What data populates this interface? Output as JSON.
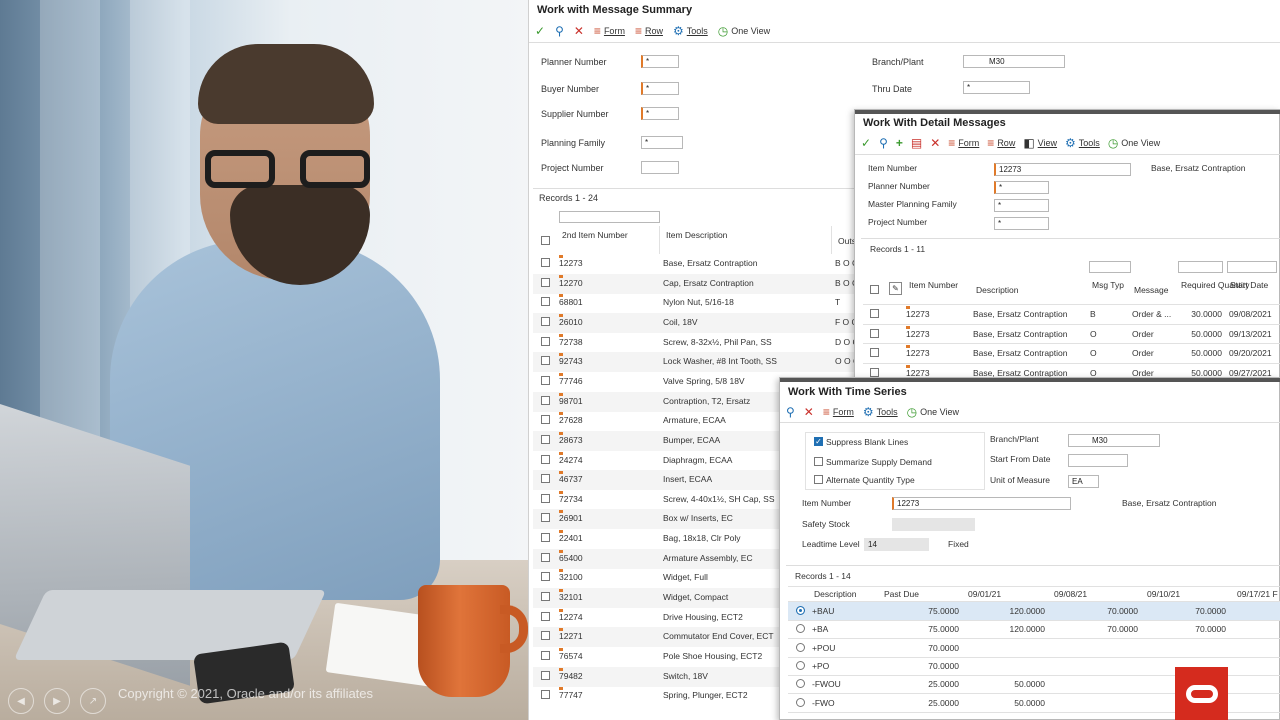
{
  "copyright": "Copyright © 2021, Oracle and/or its affiliates",
  "photo_controls": [
    "prev-icon",
    "next-icon",
    "expand-icon"
  ],
  "colors": {
    "required_flag": "#e07a2a",
    "link": "#1f5c99",
    "oracle_red": "#d52b1e"
  },
  "msg_summary": {
    "title": "Work with Message Summary",
    "toolbar": {
      "form": "Form",
      "row": "Row",
      "tools": "Tools",
      "one_view": "One View"
    },
    "fields": {
      "planner_number": {
        "label": "Planner Number",
        "value": "*"
      },
      "buyer_number": {
        "label": "Buyer Number",
        "value": "*"
      },
      "supplier_number": {
        "label": "Supplier Number",
        "value": "*"
      },
      "planning_family": {
        "label": "Planning Family",
        "value": "*"
      },
      "project_number": {
        "label": "Project Number",
        "value": ""
      },
      "branch_plant": {
        "label": "Branch/Plant",
        "value": "M30"
      },
      "thru_date": {
        "label": "Thru Date",
        "value": "*"
      }
    },
    "records_label": "Records 1 - 24",
    "columns": {
      "item_number": "2nd Item Number",
      "item_desc": "Item Description",
      "outs": "Outs"
    },
    "rows": [
      {
        "item": "12273",
        "desc": "Base, Ersatz Contraption",
        "outs": "B O C"
      },
      {
        "item": "12270",
        "desc": "Cap, Ersatz Contraption",
        "outs": "B O C"
      },
      {
        "item": "68801",
        "desc": "Nylon Nut, 5/16-18",
        "outs": "T"
      },
      {
        "item": "26010",
        "desc": "Coil, 18V",
        "outs": "F O C"
      },
      {
        "item": "72738",
        "desc": "Screw, 8-32x½, Phil Pan, SS",
        "outs": "D O C"
      },
      {
        "item": "92743",
        "desc": "Lock Washer, #8 Int Tooth, SS",
        "outs": "O O C"
      },
      {
        "item": "77746",
        "desc": "Valve Spring, 5/8 18V",
        "outs": ""
      },
      {
        "item": "98701",
        "desc": "Contraption, T2, Ersatz",
        "outs": ""
      },
      {
        "item": "27628",
        "desc": "Armature, ECAA",
        "outs": ""
      },
      {
        "item": "28673",
        "desc": "Bumper, ECAA",
        "outs": ""
      },
      {
        "item": "24274",
        "desc": "Diaphragm, ECAA",
        "outs": ""
      },
      {
        "item": "46737",
        "desc": "Insert, ECAA",
        "outs": ""
      },
      {
        "item": "72734",
        "desc": "Screw, 4-40x1½, SH Cap, SS",
        "outs": ""
      },
      {
        "item": "26901",
        "desc": "Box w/ Inserts, EC",
        "outs": ""
      },
      {
        "item": "22401",
        "desc": "Bag, 18x18, Clr Poly",
        "outs": ""
      },
      {
        "item": "65400",
        "desc": "Armature Assembly, EC",
        "outs": ""
      },
      {
        "item": "32100",
        "desc": "Widget, Full",
        "outs": ""
      },
      {
        "item": "32101",
        "desc": "Widget, Compact",
        "outs": ""
      },
      {
        "item": "12274",
        "desc": "Drive Housing, ECT2",
        "outs": ""
      },
      {
        "item": "12271",
        "desc": "Commutator End Cover, ECT",
        "outs": ""
      },
      {
        "item": "76574",
        "desc": "Pole Shoe Housing, ECT2",
        "outs": ""
      },
      {
        "item": "79482",
        "desc": "Switch, 18V",
        "outs": ""
      },
      {
        "item": "77747",
        "desc": "Spring, Plunger, ECT2",
        "outs": ""
      }
    ]
  },
  "detail_msgs": {
    "title": "Work With Detail Messages",
    "toolbar": {
      "form": "Form",
      "row": "Row",
      "view": "View",
      "tools": "Tools",
      "one_view": "One View"
    },
    "fields": {
      "item_number": {
        "label": "Item Number",
        "value": "12273",
        "desc": "Base, Ersatz Contraption"
      },
      "planner_number": {
        "label": "Planner Number",
        "value": "*"
      },
      "master_planning_family": {
        "label": "Master Planning Family",
        "value": "*"
      },
      "project_number": {
        "label": "Project Number",
        "value": "*"
      }
    },
    "records_label": "Records 1 - 11",
    "columns": {
      "item_number": "Item Number",
      "description": "Description",
      "msg_typ": "Msg Typ",
      "message": "Message",
      "req_qty": "Required Quantity",
      "start_date": "Start Date"
    },
    "rows": [
      {
        "item": "12273",
        "desc": "Base, Ersatz Contraption",
        "typ": "B",
        "msg": "Order & ...",
        "qty": "30.0000",
        "date": "09/08/2021"
      },
      {
        "item": "12273",
        "desc": "Base, Ersatz Contraption",
        "typ": "O",
        "msg": "Order",
        "qty": "50.0000",
        "date": "09/13/2021"
      },
      {
        "item": "12273",
        "desc": "Base, Ersatz Contraption",
        "typ": "O",
        "msg": "Order",
        "qty": "50.0000",
        "date": "09/20/2021"
      },
      {
        "item": "12273",
        "desc": "Base, Ersatz Contraption",
        "typ": "O",
        "msg": "Order",
        "qty": "50.0000",
        "date": "09/27/2021"
      }
    ]
  },
  "time_series": {
    "title": "Work With Time Series",
    "toolbar": {
      "form": "Form",
      "tools": "Tools",
      "one_view": "One View"
    },
    "options": {
      "suppress_blank": {
        "label": "Suppress Blank Lines",
        "checked": true
      },
      "summarize": {
        "label": "Summarize Supply Demand",
        "checked": false
      },
      "alt_qty": {
        "label": "Alternate Quantity Type",
        "checked": false
      }
    },
    "fields": {
      "branch_plant": {
        "label": "Branch/Plant",
        "value": "M30"
      },
      "start_from_date": {
        "label": "Start From Date",
        "value": ""
      },
      "uom": {
        "label": "Unit of Measure",
        "value": "EA"
      },
      "item_number": {
        "label": "Item Number",
        "value": "12273",
        "desc": "Base, Ersatz Contraption"
      },
      "safety_stock": {
        "label": "Safety Stock",
        "value": ""
      },
      "leadtime_level": {
        "label": "Leadtime Level",
        "value": "14",
        "extra": "Fixed"
      }
    },
    "records_label": "Records 1 - 14",
    "columns": [
      "Description",
      "Past Due",
      "09/01/21",
      "09/08/21",
      "09/10/21",
      "09/17/21 F"
    ],
    "rows": [
      {
        "desc": "+BAU",
        "vals": [
          "75.0000",
          "120.0000",
          "70.0000",
          "70.0000",
          ""
        ],
        "selected": true
      },
      {
        "desc": "+BA",
        "vals": [
          "75.0000",
          "120.0000",
          "70.0000",
          "70.0000",
          ""
        ],
        "selected": false
      },
      {
        "desc": "+POU",
        "vals": [
          "70.0000",
          "",
          "",
          "",
          ""
        ],
        "selected": false
      },
      {
        "desc": "+PO",
        "vals": [
          "70.0000",
          "",
          "",
          "",
          ""
        ],
        "selected": false
      },
      {
        "desc": "-FWOU",
        "vals": [
          "25.0000",
          "50.0000",
          "",
          "",
          ""
        ],
        "selected": false
      },
      {
        "desc": "-FWO",
        "vals": [
          "25.0000",
          "50.0000",
          "",
          "",
          ""
        ],
        "selected": false
      }
    ]
  }
}
